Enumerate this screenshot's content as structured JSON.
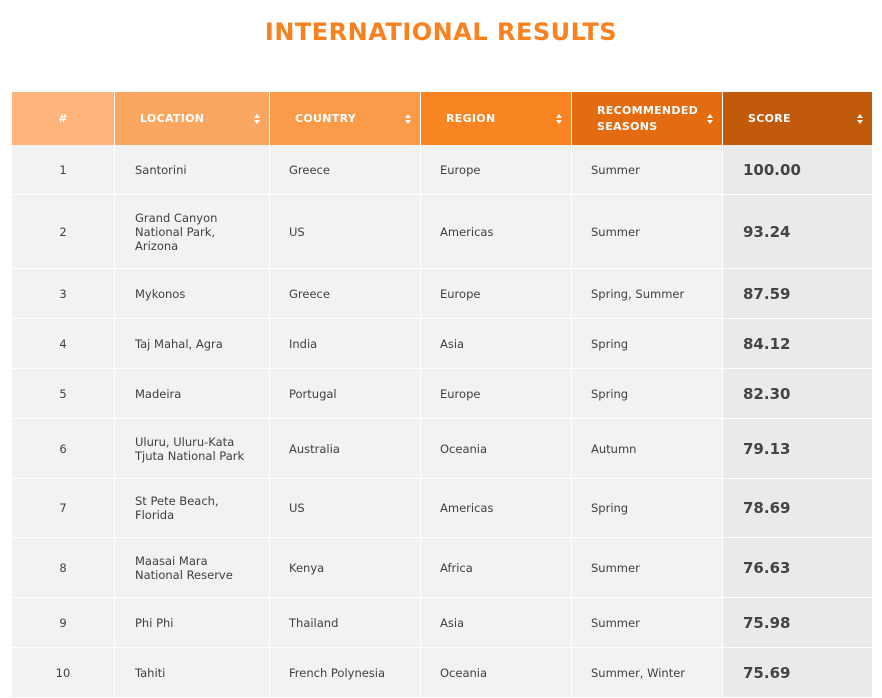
{
  "title": "INTERNATIONAL RESULTS",
  "colors": {
    "title": "#f7821f",
    "header": [
      "#fdb37a",
      "#fca761",
      "#fb9a48",
      "#f98522",
      "#e46c10",
      "#c25a0c"
    ],
    "row_bg": "#f2f2f2",
    "score_bg": "#eaeaea"
  },
  "table": {
    "headers": [
      {
        "label": "#",
        "sortable": false
      },
      {
        "label": "LOCATION",
        "sortable": true,
        "icon": "sort-icon"
      },
      {
        "label": "COUNTRY",
        "sortable": true,
        "icon": "sort-icon"
      },
      {
        "label": "REGION",
        "sortable": true,
        "icon": "sort-icon"
      },
      {
        "label": "RECOMMENDED SEASONS",
        "sortable": true,
        "icon": "sort-icon"
      },
      {
        "label": "SCORE",
        "sortable": true,
        "icon": "sort-icon"
      }
    ],
    "rows": [
      {
        "rank": "1",
        "location": "Santorini",
        "country": "Greece",
        "region": "Europe",
        "seasons": "Summer",
        "score": "100.00"
      },
      {
        "rank": "2",
        "location": "Grand Canyon National Park, Arizona",
        "country": "US",
        "region": "Americas",
        "seasons": "Summer",
        "score": "93.24"
      },
      {
        "rank": "3",
        "location": "Mykonos",
        "country": "Greece",
        "region": "Europe",
        "seasons": "Spring, Summer",
        "score": "87.59"
      },
      {
        "rank": "4",
        "location": "Taj Mahal, Agra",
        "country": "India",
        "region": "Asia",
        "seasons": "Spring",
        "score": "84.12"
      },
      {
        "rank": "5",
        "location": "Madeira",
        "country": "Portugal",
        "region": "Europe",
        "seasons": "Spring",
        "score": "82.30"
      },
      {
        "rank": "6",
        "location": "Uluru, Uluru-Kata Tjuta National Park",
        "country": "Australia",
        "region": "Oceania",
        "seasons": "Autumn",
        "score": "79.13"
      },
      {
        "rank": "7",
        "location": "St Pete Beach, Florida",
        "country": "US",
        "region": "Americas",
        "seasons": "Spring",
        "score": "78.69"
      },
      {
        "rank": "8",
        "location": "Maasai Mara National Reserve",
        "country": "Kenya",
        "region": "Africa",
        "seasons": "Summer",
        "score": "76.63"
      },
      {
        "rank": "9",
        "location": "Phi Phi",
        "country": "Thailand",
        "region": "Asia",
        "seasons": "Summer",
        "score": "75.98"
      },
      {
        "rank": "10",
        "location": "Tahiti",
        "country": "French Polynesia",
        "region": "Oceania",
        "seasons": "Summer, Winter",
        "score": "75.69"
      }
    ]
  }
}
